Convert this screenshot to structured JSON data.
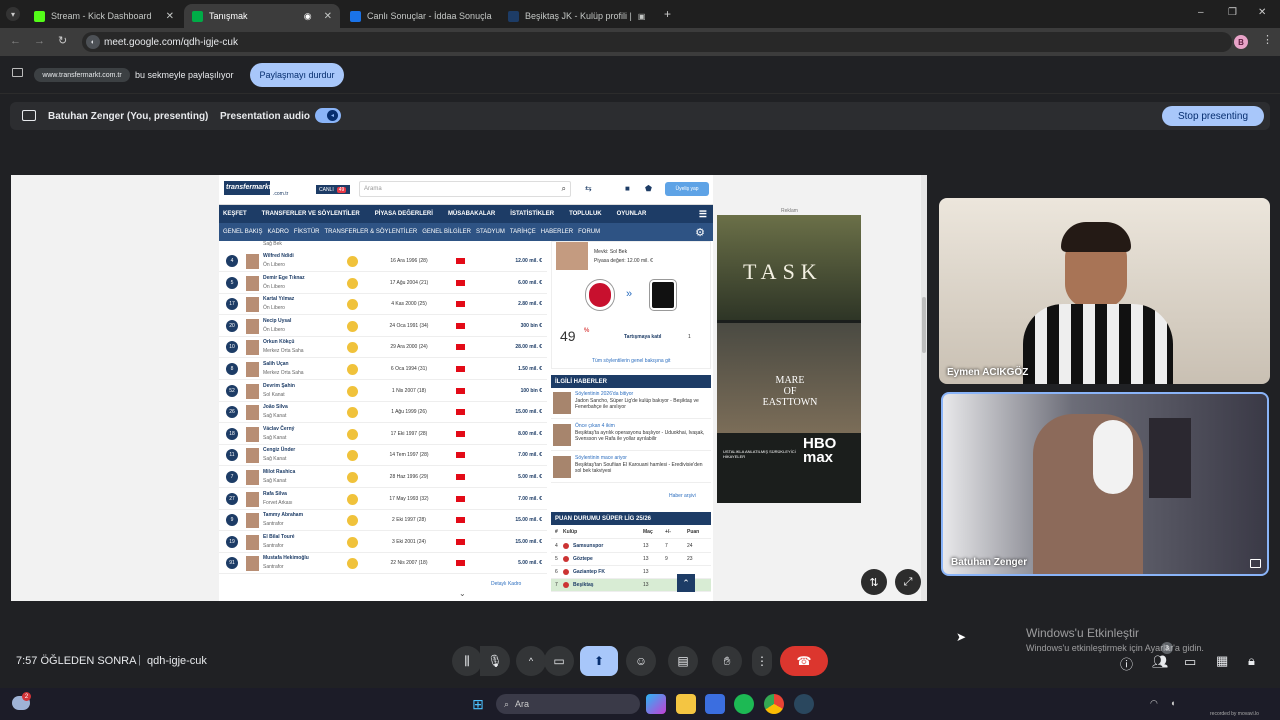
{
  "browser": {
    "tabs": [
      {
        "label": "Stream - Kick Dashboard",
        "color": "#53fc18"
      },
      {
        "label": "Tanışmak",
        "color": "#00ac47"
      },
      {
        "label": "Canlı Sonuçlar - İddaa Sonuçla",
        "color": "#1a73e8"
      },
      {
        "label": "Beşiktaş JK - Kulüp profili |",
        "color": "#1d3c66"
      }
    ],
    "url": "meet.google.com/qdh-igje-cuk",
    "profile_initial": "B",
    "new_tab": "+",
    "window_controls": [
      "–",
      "❐",
      "✕"
    ]
  },
  "share_bar": {
    "site": "www.transfermarkt.com.tr",
    "text": "bu sekmeyle paylaşılıyor",
    "stop_button": "Paylaşmayı durdur"
  },
  "presenting_bar": {
    "presenter": "Batuhan Zenger (You, presenting)",
    "audio_label": "Presentation audio",
    "stop_button": "Stop presenting"
  },
  "transfermarkt": {
    "logo": "transfermarkt",
    "logo_suffix": ".com.tr",
    "live_badge": "CANLI",
    "live_count": "49",
    "search_placeholder": "Arama",
    "signup": "Üyeliş yap",
    "nav1": [
      "KEŞFET",
      "TRANSFERLER VE SÖYLENTİLER",
      "PİYASA DEĞERLERİ",
      "MÜSABAKALAR",
      "İSTATİSTİKLER",
      "TOPLULUK",
      "OYUNLAR"
    ],
    "nav2": [
      "GENEL BAKIŞ",
      "KADRO",
      "FİKSTÜR",
      "TRANSFERLER & SÖYLENTİLER",
      "GENEL BİLGİLER",
      "STADYUM",
      "TARİHÇE",
      "HABERLER",
      "FORUM"
    ],
    "first_row_pos": "Sağ Bek",
    "players": [
      {
        "num": "4",
        "name": "Wilfred Ndidi",
        "pos": "Ön Libero",
        "date": "16 Ara 1996 (28)",
        "value": "12.00 mil. €"
      },
      {
        "num": "5",
        "name": "Demir Ege Tıknaz",
        "pos": "Ön Libero",
        "date": "17 Ağu 2004 (21)",
        "value": "6.00 mil. €"
      },
      {
        "num": "17",
        "name": "Kartal Yılmaz",
        "pos": "Ön Libero",
        "date": "4 Kas 2000 (25)",
        "value": "2.80 mil. €"
      },
      {
        "num": "20",
        "name": "Necip Uysal",
        "pos": "Ön Libero",
        "date": "24 Oca 1991 (34)",
        "value": "300 bin €"
      },
      {
        "num": "10",
        "name": "Orkun Kökçü",
        "pos": "Merkez Orta Saha",
        "date": "29 Ara 2000 (24)",
        "value": "28.00 mil. €"
      },
      {
        "num": "8",
        "name": "Salih Uçan",
        "pos": "Merkez Orta Saha",
        "date": "6 Oca 1994 (31)",
        "value": "1.50 mil. €"
      },
      {
        "num": "52",
        "name": "Devrim Şahin",
        "pos": "Sol Kanat",
        "date": "1 Nis 2007 (18)",
        "value": "100 bin €"
      },
      {
        "num": "26",
        "name": "João Silva",
        "pos": "Sağ Kanat",
        "date": "1 Ağu 1999 (26)",
        "value": "15.00 mil. €"
      },
      {
        "num": "18",
        "name": "Václav Černý",
        "pos": "Sağ Kanat",
        "date": "17 Eki 1997 (28)",
        "value": "8.00 mil. €"
      },
      {
        "num": "11",
        "name": "Cengiz Ünder",
        "pos": "Sağ Kanat",
        "date": "14 Tem 1997 (28)",
        "value": "7.00 mil. €"
      },
      {
        "num": "7",
        "name": "Milot Rashica",
        "pos": "Sağ Kanat",
        "date": "28 Haz 1996 (29)",
        "value": "5.00 mil. €"
      },
      {
        "num": "27",
        "name": "Rafa Silva",
        "pos": "Forvet Arkası",
        "date": "17 May 1993 (32)",
        "value": "7.00 mil. €"
      },
      {
        "num": "9",
        "name": "Tammy Abraham",
        "pos": "Santrafor",
        "date": "2 Eki 1997 (28)",
        "value": "15.00 mil. €"
      },
      {
        "num": "19",
        "name": "El Bilal Touré",
        "pos": "Santrafor",
        "date": "3 Eki 2001 (24)",
        "value": "15.00 mil. €"
      },
      {
        "num": "91",
        "name": "Mustafa Hekimoğlu",
        "pos": "Santrafor",
        "date": "22 Nis 2007 (18)",
        "value": "5.00 mil. €"
      }
    ],
    "squad_link": "Detaylı Kadro",
    "transfer_card": {
      "mevki": "Mevki: Sol Bek",
      "value": "Piyasa değeri: 12.00 mil. €",
      "percent": "49",
      "percent_sign": "%",
      "discuss": "Tartışmaya katıl",
      "discuss_count": "1",
      "all_rumors": "Tüm söylentilerin genel bakışına git"
    },
    "news_header": "İLGİLİ HABERLER",
    "news": [
      {
        "tag": "Söylentinin 2026'da bitiyor",
        "text": "Jadon Sancho, Süper Lig'de kulüp bakıyor - Beşiktaş ve Fenerbahçe ile anılıyor"
      },
      {
        "tag": "Önce çıkan 4 ikim",
        "text": "Beşiktaş'ta ayrılık operasyonu başlıyor - Uduokhai, Ivaşak, Svensson ve Rafa ile yollar ayrılabilir"
      },
      {
        "tag": "Söylentinin mace ariyor",
        "text": "Beşiktaş'tan Soufiian El Karouani hamlesi - Eredivisie'den sol bek takviyesi"
      }
    ],
    "more_news": "Haber arşivi",
    "standings_header": "PUAN DURUMU SÜPER LİG 25/26",
    "standings_cols": [
      "#",
      "Kulüp",
      "Maç",
      "+/-",
      "Puan"
    ],
    "standings": [
      {
        "pos": "4",
        "club": "Samsunspor",
        "m": "13",
        "gd": "7",
        "pts": "24"
      },
      {
        "pos": "5",
        "club": "Göztepe",
        "m": "13",
        "gd": "9",
        "pts": "23"
      },
      {
        "pos": "6",
        "club": "Gaziantep FK",
        "m": "13",
        "gd": "",
        "pts": ""
      },
      {
        "pos": "7",
        "club": "Beşiktaş",
        "m": "13",
        "gd": "",
        "pts": ""
      }
    ],
    "ad_label": "Reklam",
    "ad_title": "TASK",
    "ad_title2": "MARE\nOF\nEASTTOWN",
    "ad_brand": "HBO\nmax",
    "ad_text": "USTALIKLA ANLATILMIŞ SÜRÜKLEYİCİ HİKAYELER"
  },
  "participants": [
    {
      "name": "Eymen ACIKGÖZ"
    },
    {
      "name": "Batuhan Zenger"
    }
  ],
  "bottom": {
    "time": "7:57 ÖĞLEDEN SONRA",
    "separator": "|",
    "meeting_code": "qdh-igje-cuk",
    "people_count": "3",
    "activation_title": "Windows'u Etkinleştir",
    "activation_sub": "Windows'u etkinleştirmek için Ayarlar'a gidin."
  },
  "taskbar": {
    "search_placeholder": "Ara",
    "weather_badge": "2",
    "watermark": "recorded by movavi.lo"
  }
}
